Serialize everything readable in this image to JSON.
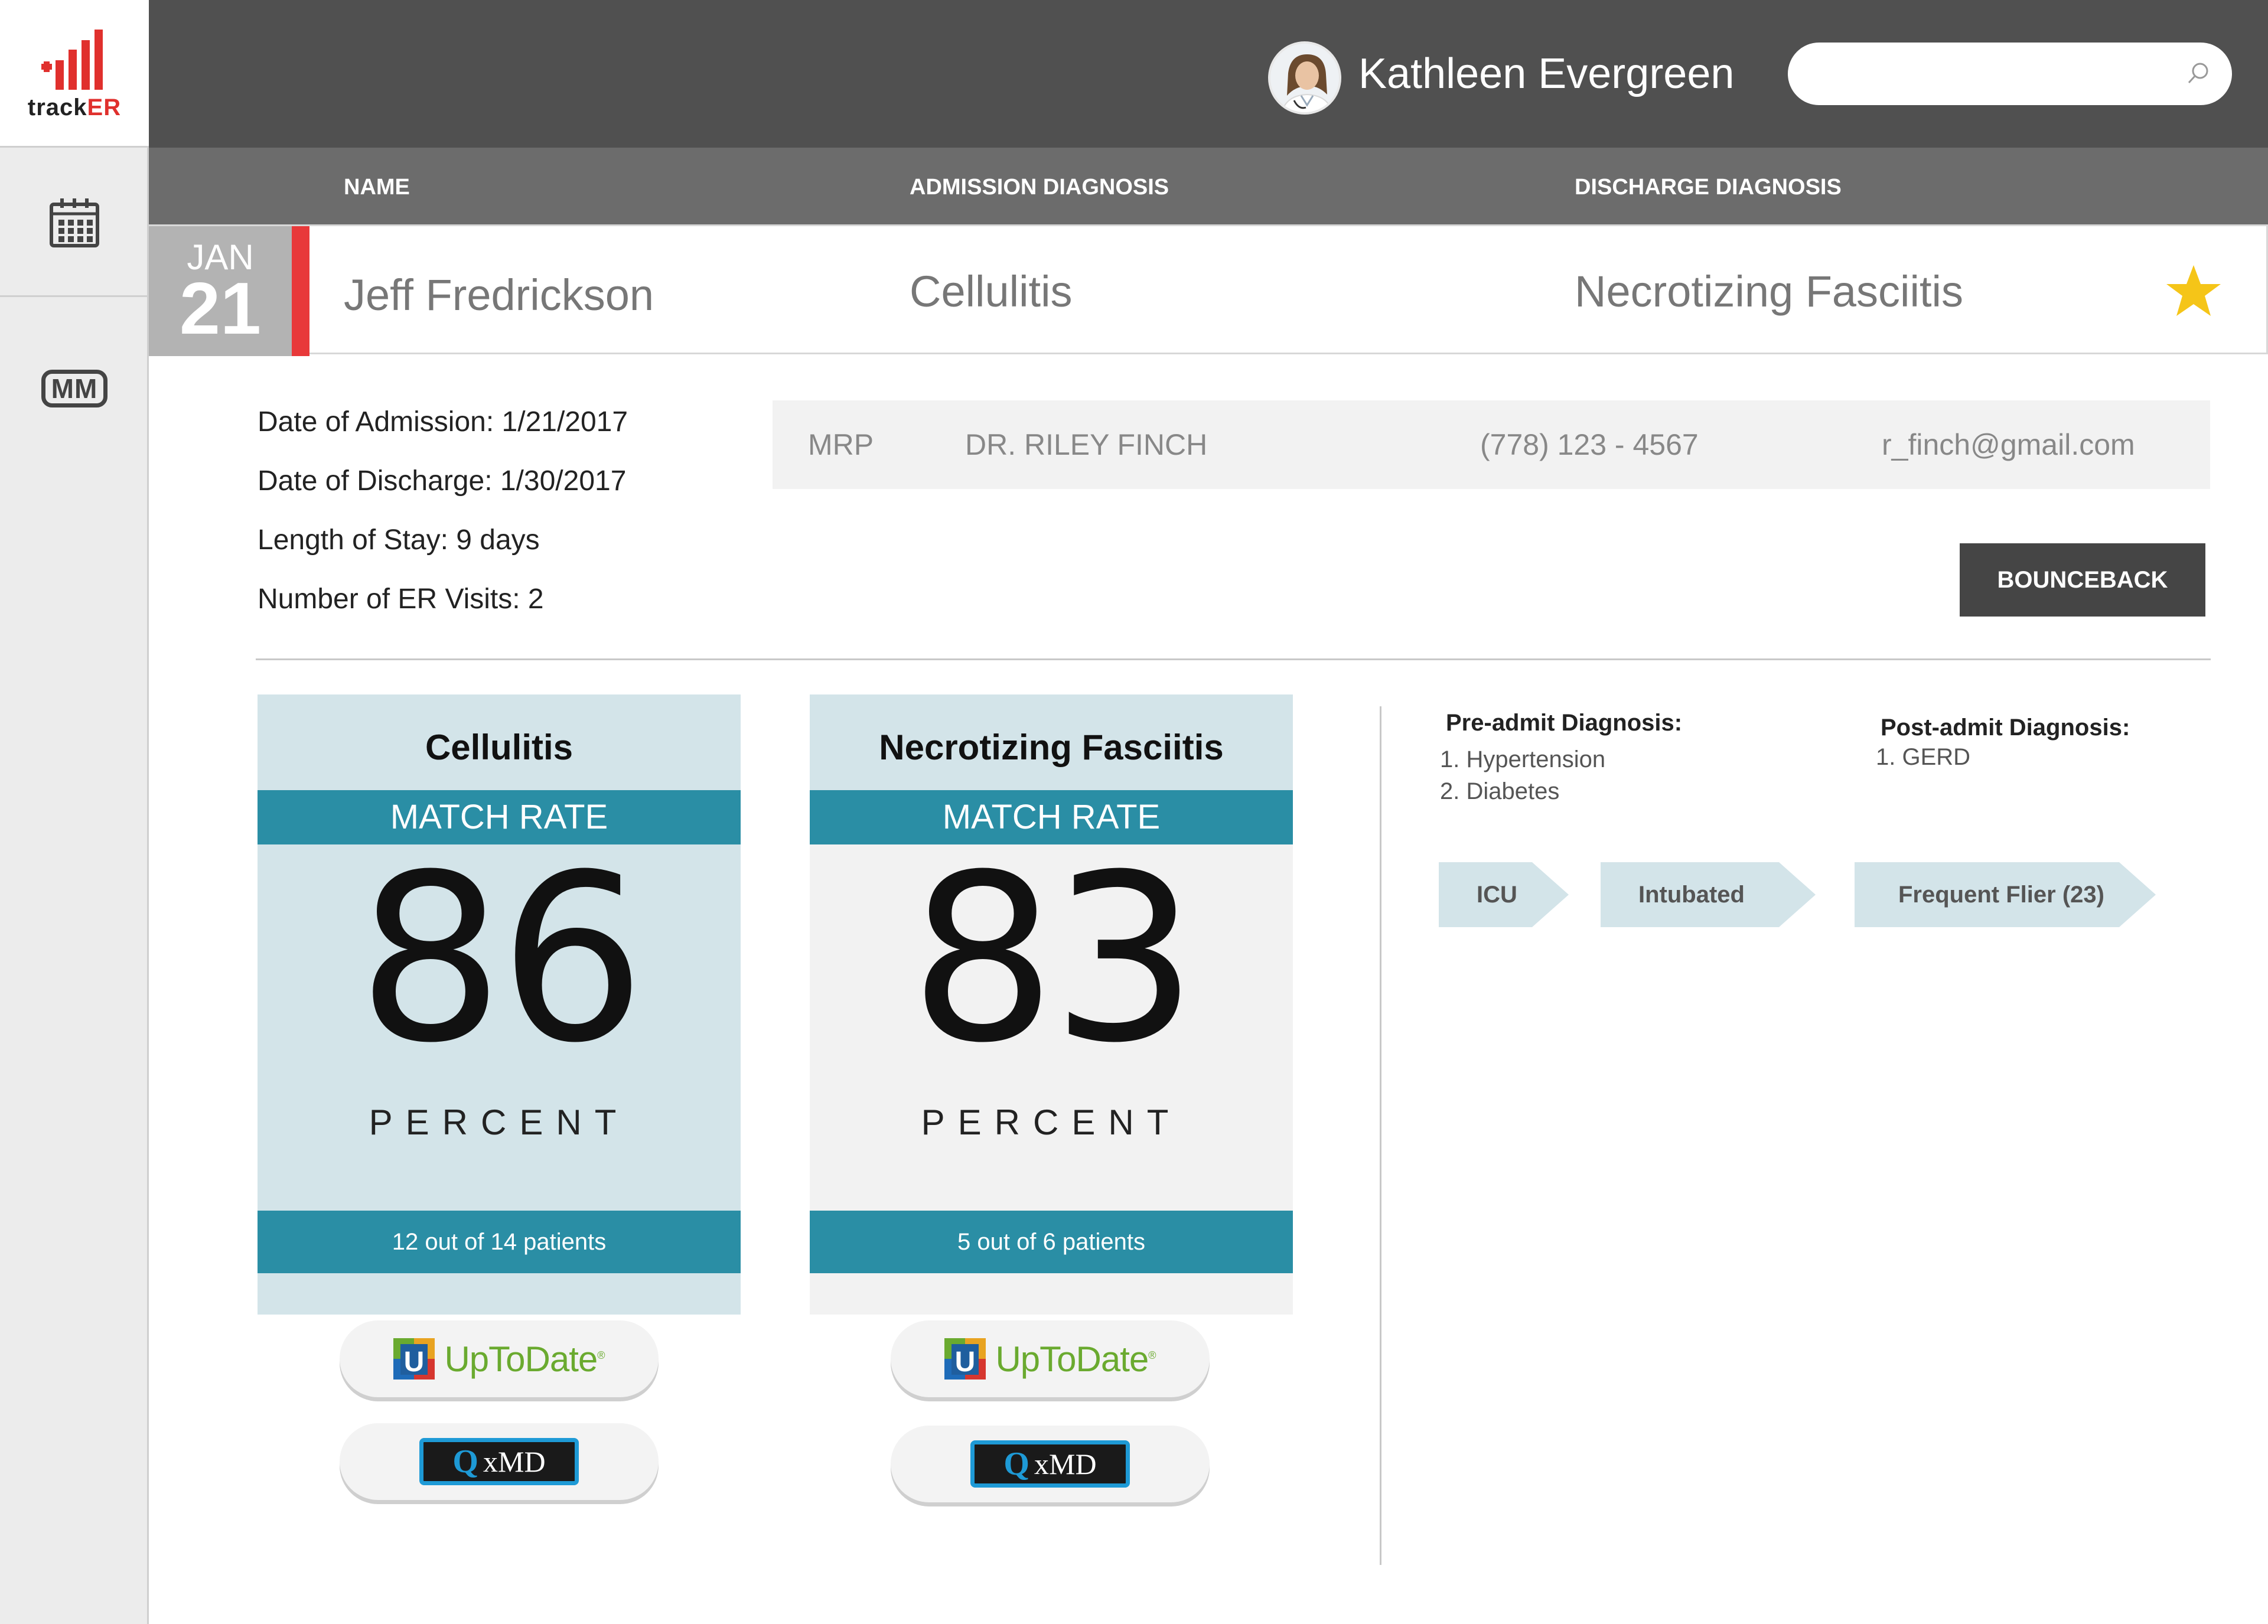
{
  "app": {
    "logo_prefix": "track",
    "logo_suffix": "ER",
    "sidebar_mm_label": "MM"
  },
  "header": {
    "user_name": "Kathleen Evergreen",
    "search_placeholder": ""
  },
  "columns": {
    "name": "NAME",
    "admission": "ADMISSION DIAGNOSIS",
    "discharge": "DISCHARGE DIAGNOSIS"
  },
  "patient": {
    "month": "JAN",
    "day": "21",
    "name": "Jeff Fredrickson",
    "admission_diagnosis": "Cellulitis",
    "discharge_diagnosis": "Necrotizing Fasciitis",
    "starred": true
  },
  "details": {
    "admission_date": "Date of Admission: 1/21/2017",
    "discharge_date": "Date of Discharge: 1/30/2017",
    "length_of_stay": "Length of Stay: 9 days",
    "er_visits": "Number of ER Visits: 2"
  },
  "mrp": {
    "label": "MRP",
    "doctor": "DR. RILEY FINCH",
    "phone": "(778) 123 - 4567",
    "email": "r_finch@gmail.com"
  },
  "bounceback_label": "BOUNCEBACK",
  "cards": [
    {
      "diagnosis": "Cellulitis",
      "match_label": "MATCH RATE",
      "value": "86",
      "unit": "PERCENT",
      "footer": "12 out of 14 patients",
      "body_color": "#d3e4e9"
    },
    {
      "diagnosis": "Necrotizing Fasciitis",
      "match_label": "MATCH RATE",
      "value": "83",
      "unit": "PERCENT",
      "footer": "5 out of 6 patients",
      "body_color": "#f2f2f2"
    }
  ],
  "resources": {
    "uptodate_label": "UpToDate",
    "uptodate_mark": "®",
    "qxmd_label": "QxMD"
  },
  "diagnosis_panel": {
    "pre_admit_title": "Pre-admit Diagnosis:",
    "pre_admit": [
      "1. Hypertension",
      "2. Diabetes"
    ],
    "post_admit_title": "Post-admit Diagnosis:",
    "post_admit": [
      "1. GERD"
    ]
  },
  "tags": [
    "ICU",
    "Intubated",
    "Frequent Flier (23)"
  ],
  "colors": {
    "accent_teal": "#2a8ea5",
    "light_teal": "#d3e4e9",
    "alert_red": "#e8393a",
    "star_yellow": "#f5c518",
    "topbar": "#505050"
  },
  "icons": [
    "bar-chart-logo-icon",
    "calendar-icon",
    "mm-icon",
    "search-icon",
    "star-icon"
  ]
}
